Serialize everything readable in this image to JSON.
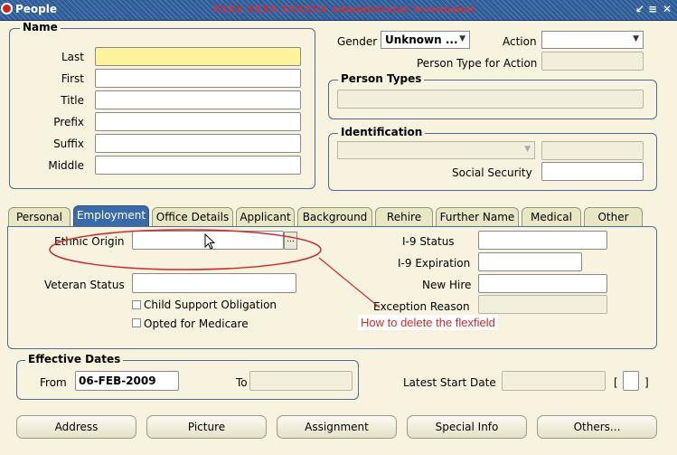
{
  "window": {
    "title": "People",
    "watermark": "XXXX XXXX XXXXXX Administrator Screenshot",
    "buttons": [
      "↙",
      "≡",
      "✕"
    ]
  },
  "name_group": {
    "label": "Name",
    "fields": [
      "Last",
      "First",
      "Title",
      "Prefix",
      "Suffix",
      "Middle"
    ]
  },
  "gender": {
    "label": "Gender",
    "value": "Unknown ..."
  },
  "action": {
    "label": "Action",
    "value": ""
  },
  "person_type_for_action": {
    "label": "Person Type for Action"
  },
  "person_types": {
    "label": "Person Types"
  },
  "identification": {
    "label": "Identification",
    "social_security_label": "Social Security"
  },
  "tabs": [
    {
      "label": "Personal",
      "active": false
    },
    {
      "label": "Employment",
      "active": true
    },
    {
      "label": "Office Details",
      "active": false
    },
    {
      "label": "Applicant",
      "active": false
    },
    {
      "label": "Background",
      "active": false
    },
    {
      "label": "Rehire",
      "active": false
    },
    {
      "label": "Further Name",
      "active": false
    },
    {
      "label": "Medical",
      "active": false
    },
    {
      "label": "Other",
      "active": false
    }
  ],
  "employment": {
    "ethnic_origin_label": "Ethnic Origin",
    "veteran_status_label": "Veteran Status",
    "child_support_label": "Child Support Obligation",
    "medicare_label": "Opted for Medicare",
    "i9_status_label": "I-9  Status",
    "i9_expiration_label": "I-9  Expiration",
    "new_hire_label": "New Hire",
    "exception_reason_label": "Exception Reason",
    "lov_button": "..."
  },
  "annotation": {
    "text": "How to delete the flexfield",
    "color": "#d02a2a"
  },
  "effective_dates": {
    "label": "Effective Dates",
    "from_label": "From",
    "from_value": "06-FEB-2009",
    "to_label": "To",
    "latest_start_label": "Latest Start Date",
    "bracket_open": "[",
    "bracket_close": "]"
  },
  "bottom_buttons": [
    "Address",
    "Picture",
    "Assignment",
    "Special Info",
    "Others..."
  ],
  "colors": {
    "titlebar": "#2e5d9a",
    "background": "#f7f3de",
    "active_tab": "#3a6aa8",
    "required_field": "#fcf49c"
  }
}
